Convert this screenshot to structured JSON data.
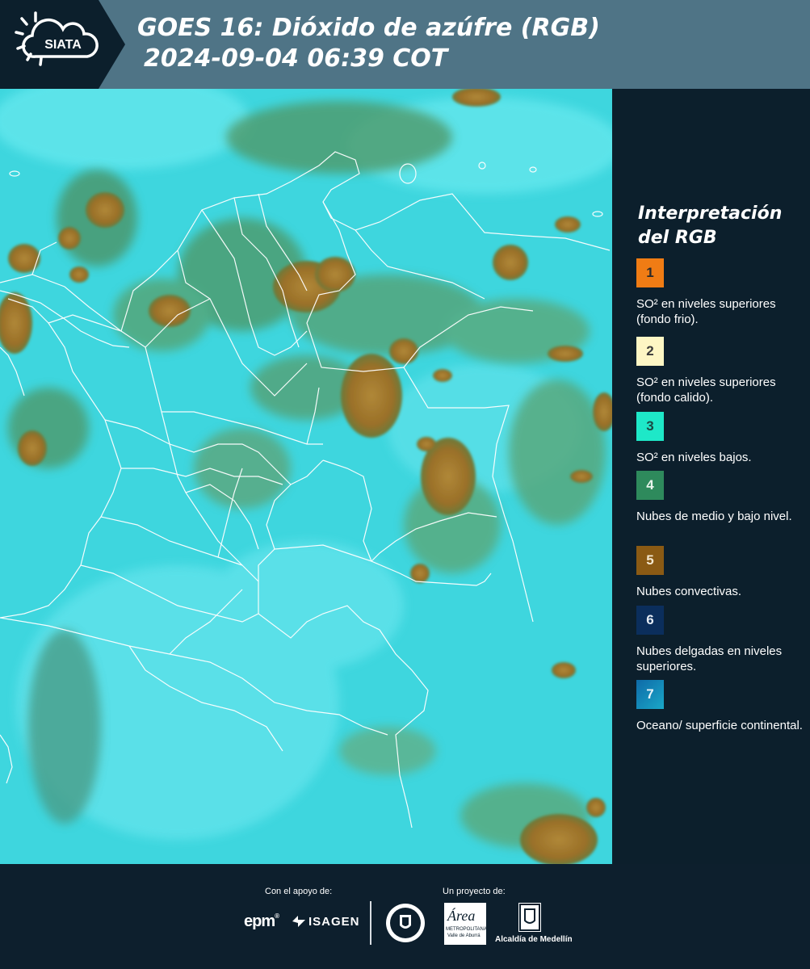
{
  "header": {
    "logo_text": "SIATA",
    "title_line1": "GOES 16: Dióxido de azúfre (RGB)",
    "title_line2": "2024-09-04 06:39 COT"
  },
  "legend": {
    "title_line1": "Interpretación",
    "title_line2": "del RGB",
    "items": [
      {
        "number": "1",
        "color": "#f07c14",
        "num_color": "#2a2a2a",
        "text": "SO² en niveles superiores (fondo frio)."
      },
      {
        "number": "2",
        "color": "#fdf6c4",
        "num_color": "#3a3a3a",
        "text": "SO² en niveles superiores (fondo calido)."
      },
      {
        "number": "3",
        "color": "#1ee8c8",
        "num_color": "#1a4a44",
        "text": "SO² en niveles bajos."
      },
      {
        "number": "4",
        "color": "#2e8a5c",
        "num_color": "#e8f4ec",
        "text": "Nubes de medio y bajo nivel."
      },
      {
        "number": "5",
        "color": "#8a5a14",
        "num_color": "#f4e8d0",
        "text": "Nubes convectivas."
      },
      {
        "number": "6",
        "color": "#0b2e5c",
        "num_color": "#e6ecf4",
        "text": "Nubes delgadas en niveles superiores."
      },
      {
        "number": "7",
        "color": "#1282b4",
        "num_color": "#e6f2f8",
        "text": "Oceano/ superficie continental."
      }
    ]
  },
  "footer": {
    "support_label": "Con el apoyo de:",
    "project_label": "Un proyecto de:",
    "logo_epm": "epm",
    "logo_isagen": "ISAGEN",
    "logo_medellin_seal": "MEDELLÍN",
    "logo_area_name": "Área",
    "logo_area_sub1": "METROPOLITANA",
    "logo_area_sub2": "Valle de Aburrá",
    "logo_alcaldia": "Alcaldía de Medellín"
  },
  "map_colors": {
    "background": "#3ed8e0",
    "light_cyan": "#5ee6ec",
    "green_cloud": "#4f9a66",
    "convective": "#a0782a",
    "convective_light": "#b8903e",
    "border_lines": "#ffffff"
  }
}
